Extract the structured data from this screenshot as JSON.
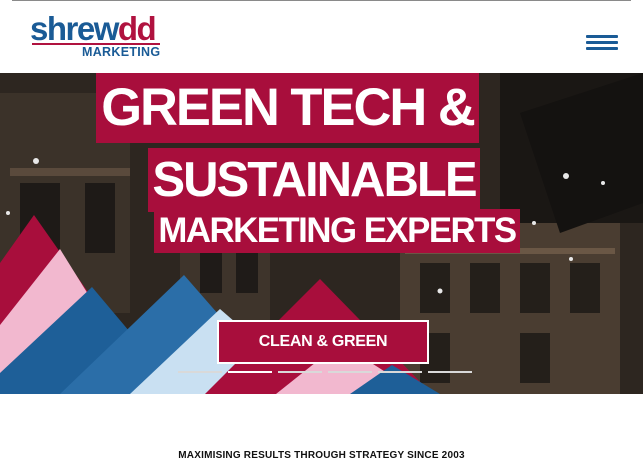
{
  "header": {
    "logo": {
      "word_main": "shrew",
      "word_accent": "dd",
      "sub": "MARKETING"
    },
    "menu_icon": "hamburger-menu-icon"
  },
  "hero": {
    "headline_line1": "GREEN TECH &",
    "headline_line2": "SUSTAINABLE",
    "headline_line3": "MARKETING EXPERTS",
    "cta_label": "CLEAN & GREEN",
    "slides": [
      {
        "active": false
      },
      {
        "active": true
      },
      {
        "active": false
      },
      {
        "active": false
      },
      {
        "active": false
      },
      {
        "active": false
      }
    ]
  },
  "tagline": "MAXIMISING RESULTS THROUGH STRATEGY SINCE 2003",
  "colors": {
    "brand_blue": "#1a5b96",
    "brand_red": "#a80e3c",
    "pink": "#f2b8cf",
    "light_blue": "#c9e0f2",
    "mid_blue": "#2b6ea8"
  }
}
